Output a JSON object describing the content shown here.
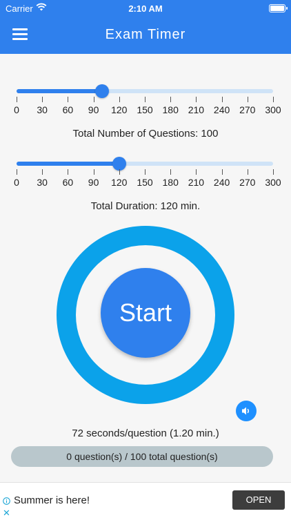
{
  "status_bar": {
    "carrier": "Carrier",
    "time": "2:10 AM"
  },
  "app_bar": {
    "title": "Exam Timer",
    "menu_icon": "hamburger-menu-icon"
  },
  "questions_slider": {
    "min": 0,
    "max": 300,
    "value": 100,
    "tick_labels": [
      "0",
      "30",
      "60",
      "90",
      "120",
      "150",
      "180",
      "210",
      "240",
      "270",
      "300"
    ],
    "caption": "Total Number of Questions: 100"
  },
  "duration_slider": {
    "min": 0,
    "max": 300,
    "value": 120,
    "tick_labels": [
      "0",
      "30",
      "60",
      "90",
      "120",
      "150",
      "180",
      "210",
      "240",
      "270",
      "300"
    ],
    "caption": "Total Duration: 120 min."
  },
  "timer": {
    "start_label": "Start",
    "sound_icon": "speaker-icon"
  },
  "rate_text": "72 seconds/question (1.20 min.)",
  "progress_text": "0 question(s) / 100 total question(s)",
  "ad": {
    "text": "Summer is here!",
    "button": "OPEN",
    "info_icon": "info-icon",
    "close_icon": "close-icon"
  },
  "colors": {
    "primary": "#2f80ed",
    "ring": "#0ba2ea",
    "track_inactive": "#cfe3f7",
    "progress_bg": "#b9c7cc"
  }
}
